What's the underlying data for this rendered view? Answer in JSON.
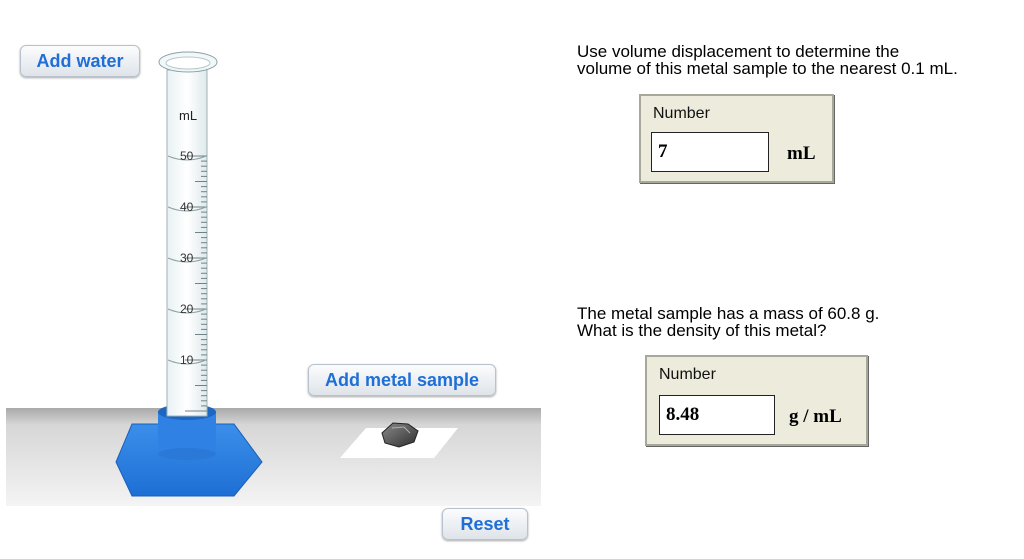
{
  "buttons": {
    "add_water": "Add water",
    "add_metal_sample": "Add metal sample",
    "reset": "Reset"
  },
  "cylinder": {
    "unit_label": "mL",
    "tick_labels": [
      "50",
      "40",
      "30",
      "20",
      "10"
    ]
  },
  "question1": {
    "line1": "Use volume displacement to determine the",
    "line2": "volume of this metal sample to the nearest 0.1 mL.",
    "box_label": "Number",
    "value": "7",
    "unit": "mL"
  },
  "question2": {
    "line1": "The metal sample has a mass of 60.8 g.",
    "line2": "What is the density of this metal?",
    "box_label": "Number",
    "value": "8.48",
    "unit": "g / mL"
  },
  "colors": {
    "accent_text": "#1f6fd6",
    "cylinder_base": "#2d7fe0",
    "box_bg": "#ecebdc"
  }
}
